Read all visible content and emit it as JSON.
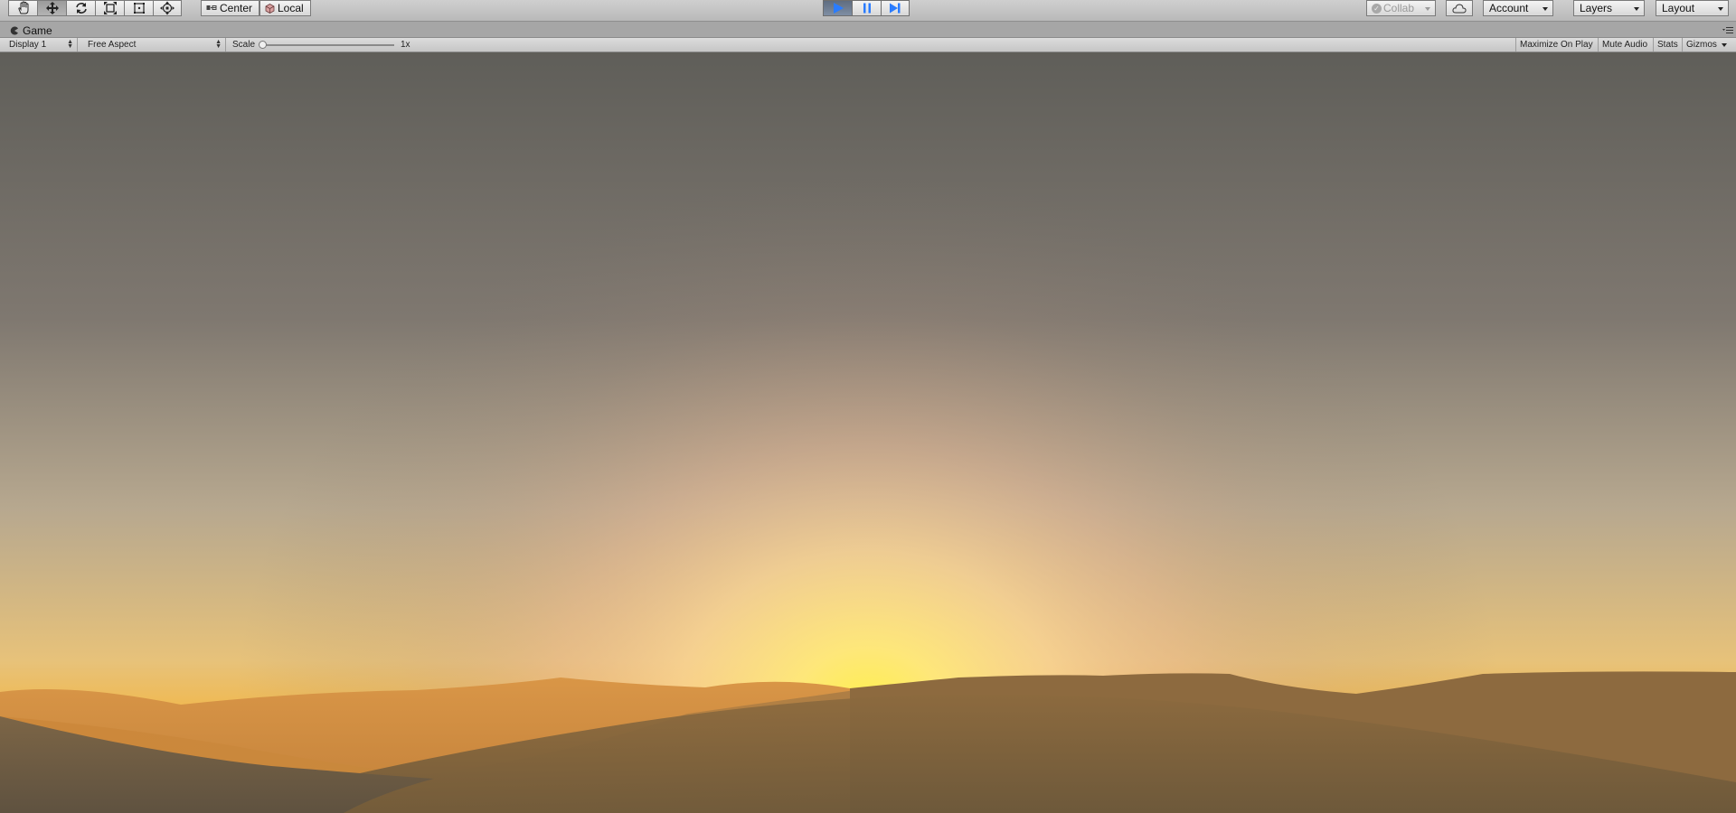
{
  "toolbar": {
    "tools": [
      {
        "name": "hand-tool",
        "icon": "hand-icon"
      },
      {
        "name": "move-tool",
        "icon": "move-icon",
        "active": true
      },
      {
        "name": "rotate-tool",
        "icon": "rotate-icon"
      },
      {
        "name": "scale-tool",
        "icon": "scale-icon"
      },
      {
        "name": "rect-tool",
        "icon": "rect-icon"
      },
      {
        "name": "transform-tool",
        "icon": "transform-icon"
      }
    ],
    "pivot_label": "Center",
    "rotation_label": "Local",
    "play_state": "playing",
    "collab_label": "Collab",
    "account_label": "Account",
    "layers_label": "Layers",
    "layout_label": "Layout"
  },
  "tab": {
    "title": "Game",
    "icon": "game-view-icon"
  },
  "gamebar": {
    "display": "Display 1",
    "aspect": "Free Aspect",
    "scale_label": "Scale",
    "scale_value": "1x",
    "maximize_label": "Maximize On Play",
    "mute_label": "Mute Audio",
    "stats_label": "Stats",
    "gizmos_label": "Gizmos"
  },
  "colors": {
    "play_accent": "#2a7cff",
    "sky_top": "#5f5e59",
    "sky_glow": "#ffe56e",
    "dune_light": "#d1883a",
    "dune_dark": "#7a6039"
  }
}
